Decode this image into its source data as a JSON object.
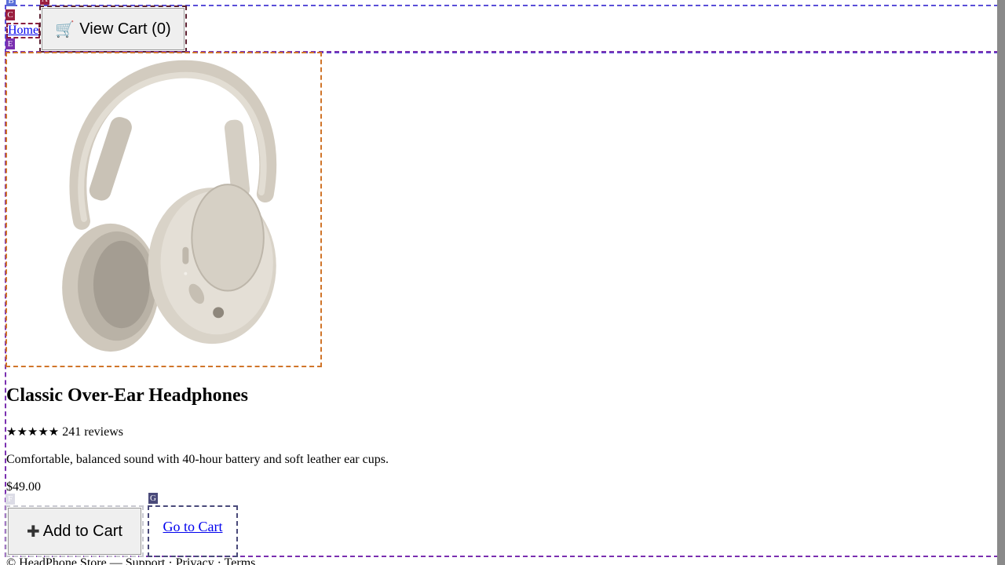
{
  "header": {
    "home_label": "Home",
    "cart_label": "View Cart (0)",
    "cart_icon": "shopping-cart-icon"
  },
  "markers": {
    "header": "B",
    "cart": "A",
    "home": "C",
    "main": "E",
    "add_to_cart": "F",
    "go_to_cart": "G"
  },
  "product": {
    "title": "Classic Over-Ear Headphones",
    "stars": "★★★★★",
    "rating_value": 5,
    "reviews": "241 reviews",
    "description": "Comfortable, balanced sound with 40-hour battery and soft leather ear cups.",
    "price": "$49.00",
    "image_alt": "Beige over-ear headphones"
  },
  "actions": {
    "add_to_cart_label": "Add to Cart",
    "add_icon": "plus-icon",
    "go_to_cart_label": "Go to Cart"
  },
  "footer": {
    "text": "© HeadPhone Store — Support · Privacy · Terms"
  },
  "colors": {
    "link": "#0000ee",
    "headphone_body": "#d9d3c8",
    "header_outline": "#5a4fd8",
    "main_outline": "#7a2fb0",
    "image_outline": "#d0752a"
  }
}
